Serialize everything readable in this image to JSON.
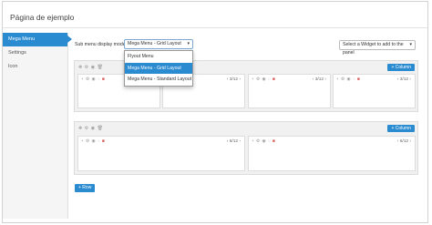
{
  "page": {
    "title": "Página de ejemplo"
  },
  "sidebar": {
    "items": [
      {
        "label": "Mega Menu",
        "active": true
      },
      {
        "label": "Settings",
        "active": false
      },
      {
        "label": "Icon",
        "active": false
      }
    ]
  },
  "toolbar": {
    "submenu_label": "Sub menu display mode",
    "submenu_value": "Mega Menu - Grid Layout",
    "widget_placeholder": "Select a Widget to add to the panel"
  },
  "dropdown": {
    "options": [
      "Flyout Menu",
      "Mega Menu - Grid Layout",
      "Mega Menu - Standard Layout"
    ],
    "selected_index": 1
  },
  "rows": [
    {
      "add_column_label": "+ Column",
      "columns": [
        {
          "size": "3/12"
        },
        {
          "size": "3/12"
        },
        {
          "size": "3/12"
        },
        {
          "size": "3/12"
        }
      ]
    },
    {
      "add_column_label": "+ Column",
      "columns": [
        {
          "size": "6/12"
        },
        {
          "size": "6/12"
        }
      ]
    }
  ],
  "add_row_label": "+ Row",
  "icons": {
    "row_tools": [
      "move-icon",
      "gear-icon",
      "eye-icon",
      "trash-icon"
    ],
    "col_tools": [
      "plus-icon",
      "gear-icon",
      "eye-icon",
      "trash-icon"
    ],
    "collapse": "‹"
  },
  "colors": {
    "accent": "#2a8bd0",
    "danger": "#d9534f"
  }
}
